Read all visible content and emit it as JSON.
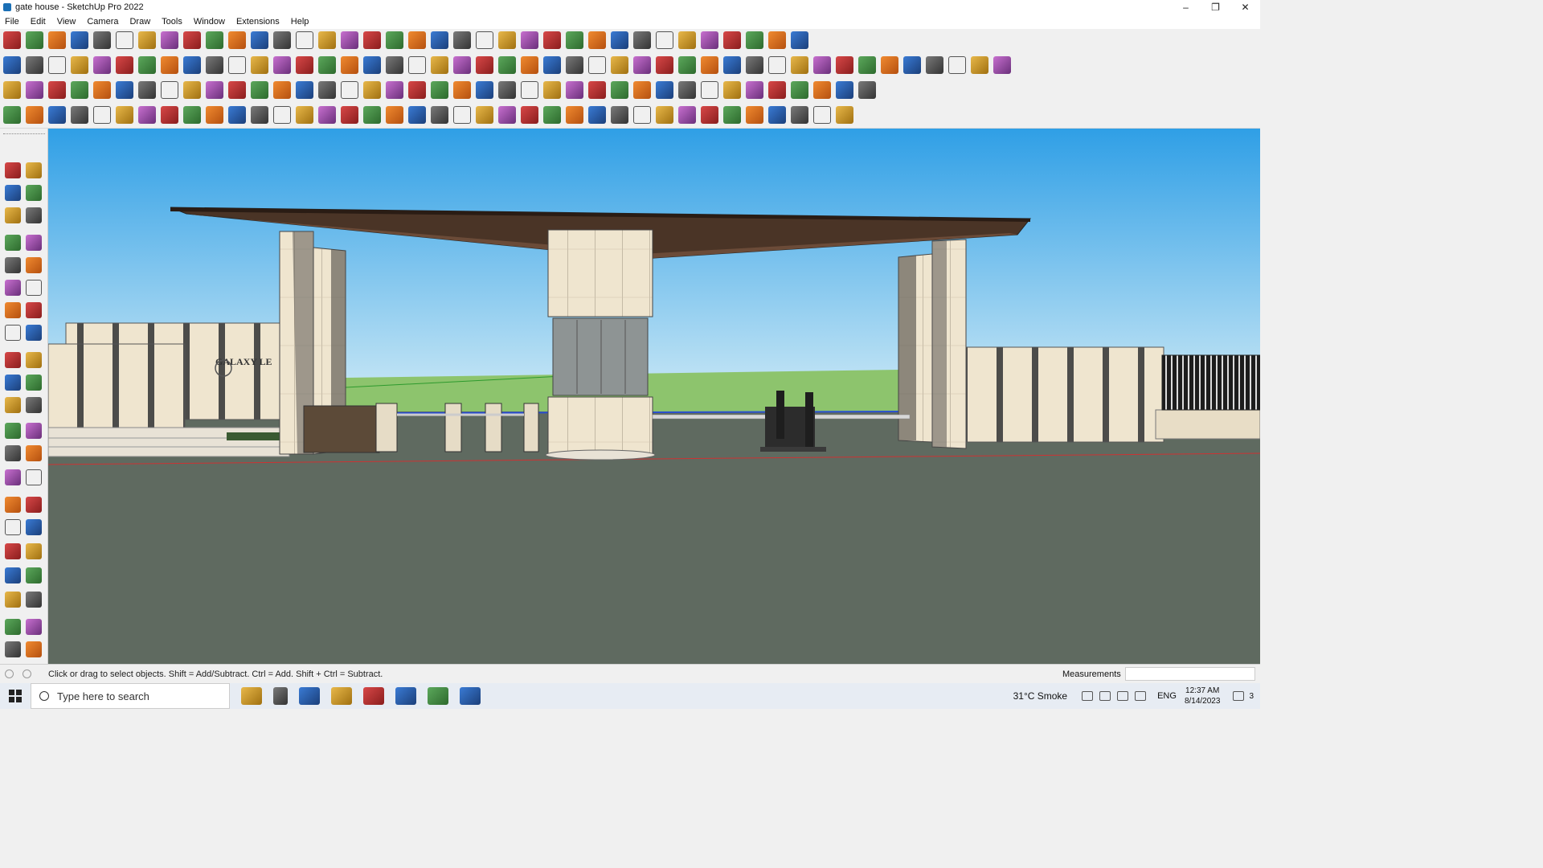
{
  "window": {
    "title": "gate house - SketchUp Pro 2022",
    "controls": [
      "minimize-icon",
      "restore-icon",
      "close-icon"
    ]
  },
  "menu": [
    "File",
    "Edit",
    "View",
    "Camera",
    "Draw",
    "Tools",
    "Window",
    "Extensions",
    "Help"
  ],
  "toolbars": {
    "rows": 4,
    "icons": [
      "search-icon",
      "select-icon",
      "eraser-icon",
      "pencil-icon",
      "lasso-icon",
      "paint-icon",
      "push-pull-icon",
      "rotate-icon",
      "scale-icon",
      "tape-icon",
      "text-icon",
      "walk-icon",
      "zoom-icon",
      "zoom-extents-icon",
      "section-icon",
      "layers-icon",
      "components-icon",
      "shadows-icon",
      "styles-icon"
    ]
  },
  "model": {
    "sign_text": "GALAXY LE"
  },
  "status": {
    "hint": "Click or drag to select objects. Shift = Add/Subtract. Ctrl = Add. Shift + Ctrl = Subtract.",
    "measurements_label": "Measurements",
    "measurements_value": ""
  },
  "taskbar": {
    "search_placeholder": "Type here to search",
    "weather": "31°C  Smoke",
    "language": "ENG",
    "time": "12:37 AM",
    "date": "8/14/2023",
    "notification_count": "3"
  },
  "colors": {
    "sky_top": "#2f9fe6",
    "sky_bottom": "#bfe2f3",
    "ground": "#5f6a60",
    "grass": "#8dc46d",
    "stone": "#eee3cc",
    "roof": "#4a3426"
  }
}
